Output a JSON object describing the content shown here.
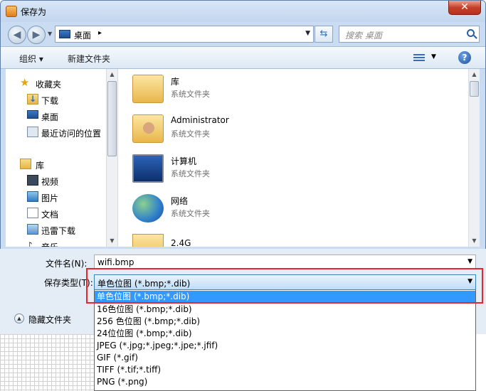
{
  "window": {
    "title": "保存为",
    "close_label": "✕"
  },
  "address_bar": {
    "location": "桌面",
    "separator": "▸",
    "search_placeholder": "搜索 桌面"
  },
  "toolbar": {
    "organize_label": "组织 ▾",
    "new_folder_label": "新建文件夹",
    "help_label": "?"
  },
  "nav_pane": {
    "favorites": "收藏夹",
    "favorites_items": [
      "下载",
      "桌面",
      "最近访问的位置"
    ],
    "libraries": "库",
    "library_items": [
      "视频",
      "图片",
      "文档",
      "迅雷下载",
      "音乐"
    ]
  },
  "files": [
    {
      "name": "库",
      "type": "系统文件夹"
    },
    {
      "name": "Administrator",
      "type": "系统文件夹"
    },
    {
      "name": "计算机",
      "type": "系统文件夹"
    },
    {
      "name": "网络",
      "type": "系统文件夹"
    },
    {
      "name": "2.4G",
      "type": ""
    }
  ],
  "form": {
    "filename_label": "文件名(N):",
    "filename_value": "wifi.bmp",
    "filetype_label": "保存类型(T):",
    "filetype_value": "单色位图 (*.bmp;*.dib)",
    "hide_folders_label": "隐藏文件夹"
  },
  "filetype_options": [
    "单色位图 (*.bmp;*.dib)",
    "16色位图 (*.bmp;*.dib)",
    "256 色位图 (*.bmp;*.dib)",
    "24位位图 (*.bmp;*.dib)",
    "JPEG (*.jpg;*.jpeg;*.jpe;*.jfif)",
    "GIF (*.gif)",
    "TIFF (*.tif;*.tiff)",
    "PNG (*.png)"
  ],
  "colors": {
    "selection": "#3399ff",
    "highlight_border": "#e8262b"
  }
}
